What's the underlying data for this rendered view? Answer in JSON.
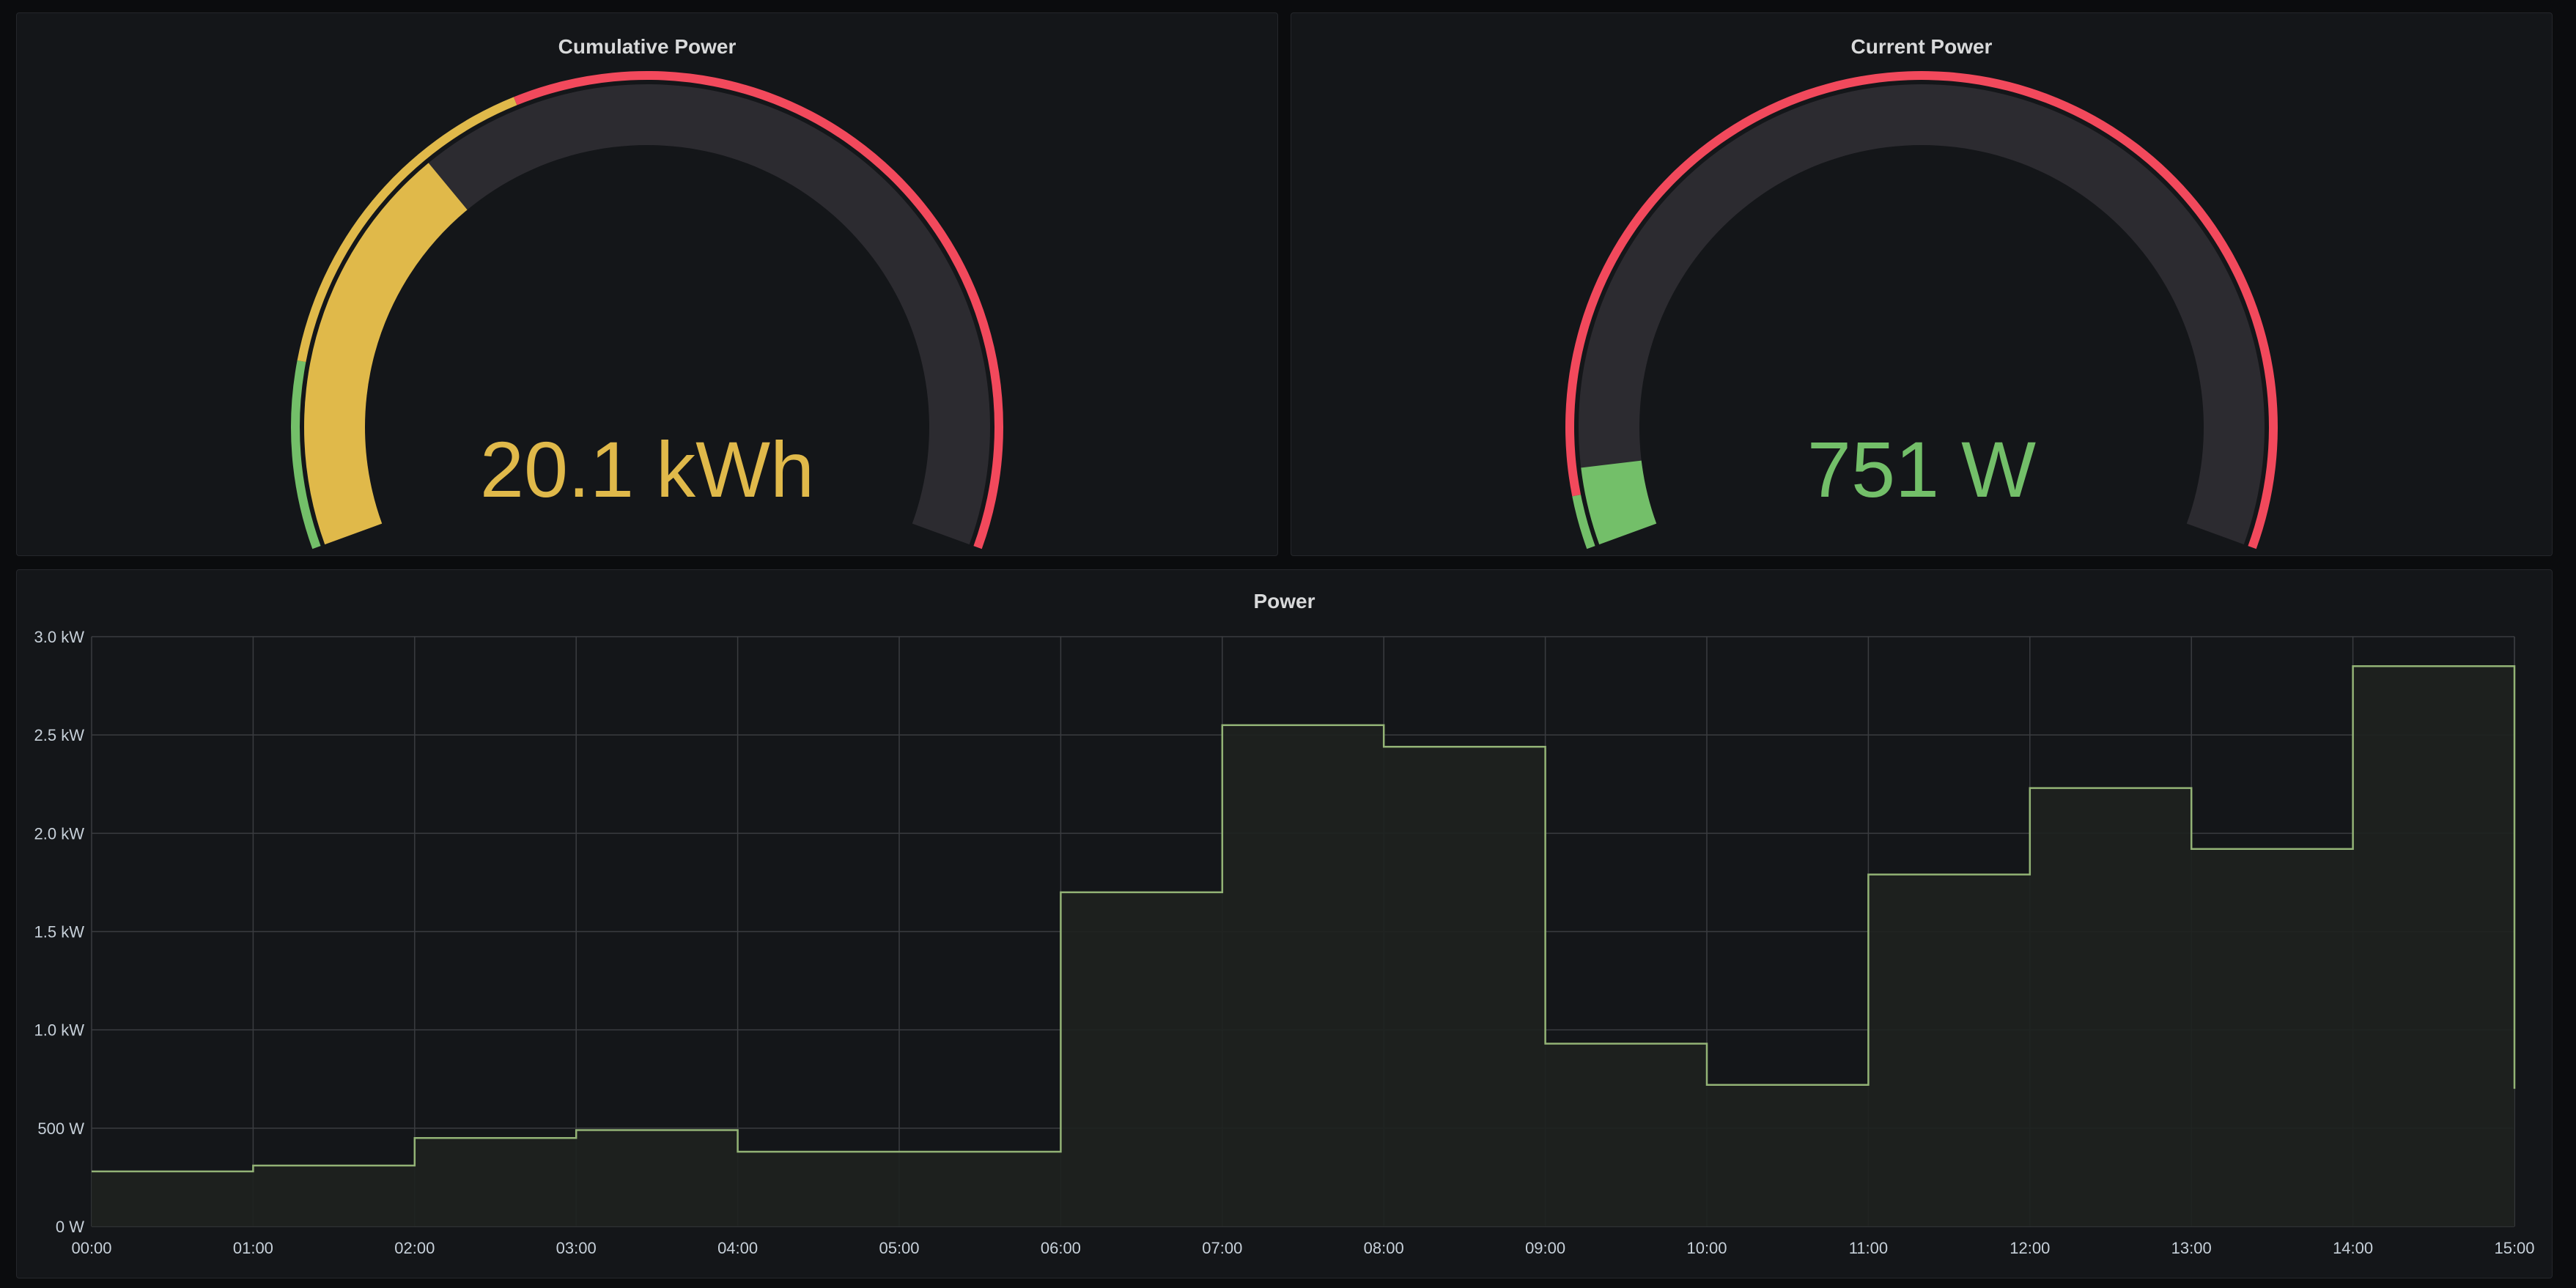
{
  "colors": {
    "background": "#0b0c0e",
    "panel": "#141619",
    "gauge_track": "#2c2b30",
    "green": "#73bf69",
    "yellow": "#e0b94a",
    "red": "#f2495c",
    "line": "#93b376",
    "fill": "#1e211f",
    "grid": "#3a3c40",
    "text": "#d8d9da"
  },
  "panels": {
    "cumulative": {
      "title": "Cumulative Power"
    },
    "current": {
      "title": "Current Power"
    },
    "power": {
      "title": "Power"
    }
  },
  "chart_data": [
    {
      "type": "gauge",
      "title": "Cumulative Power",
      "value": 20.1,
      "display_value": "20.1 kWh",
      "unit": "kWh",
      "value_fraction": 0.32,
      "value_color": "#e0b94a",
      "thresholds": [
        {
          "from": 0,
          "to": 0.14,
          "color": "#73bf69"
        },
        {
          "from": 0.14,
          "to": 0.4,
          "color": "#e0b94a"
        },
        {
          "from": 0.4,
          "to": 1,
          "color": "#f2495c"
        }
      ]
    },
    {
      "type": "gauge",
      "title": "Current Power",
      "value": 751,
      "display_value": "751 W",
      "unit": "W",
      "value_fraction": 0.06,
      "value_color": "#73bf69",
      "thresholds": [
        {
          "from": 0,
          "to": 0.04,
          "color": "#73bf69"
        },
        {
          "from": 0.04,
          "to": 1,
          "color": "#f2495c"
        }
      ]
    },
    {
      "type": "area",
      "title": "Power",
      "series": [
        {
          "x": [
            "00:00",
            "01:00",
            "02:00",
            "03:00",
            "04:00",
            "05:00",
            "06:00",
            "07:00",
            "08:00",
            "09:00",
            "10:00",
            "11:00",
            "12:00",
            "13:00",
            "14:00",
            "15:00"
          ],
          "values": [
            280,
            310,
            450,
            490,
            380,
            380,
            1700,
            2550,
            2440,
            930,
            720,
            1790,
            2230,
            1920,
            2850,
            700
          ]
        }
      ],
      "x_ticks": [
        "00:00",
        "01:00",
        "02:00",
        "03:00",
        "04:00",
        "05:00",
        "06:00",
        "07:00",
        "08:00",
        "09:00",
        "10:00",
        "11:00",
        "12:00",
        "13:00",
        "14:00",
        "15:00"
      ],
      "y_ticks": [
        {
          "value": 0,
          "label": "0 W"
        },
        {
          "value": 500,
          "label": "500 W"
        },
        {
          "value": 1000,
          "label": "1.0 kW"
        },
        {
          "value": 1500,
          "label": "1.5 kW"
        },
        {
          "value": 2000,
          "label": "2.0 kW"
        },
        {
          "value": 2500,
          "label": "2.5 kW"
        },
        {
          "value": 3000,
          "label": "3.0 kW"
        }
      ],
      "ylim": [
        0,
        3000
      ],
      "step": "after",
      "grid": true
    }
  ]
}
